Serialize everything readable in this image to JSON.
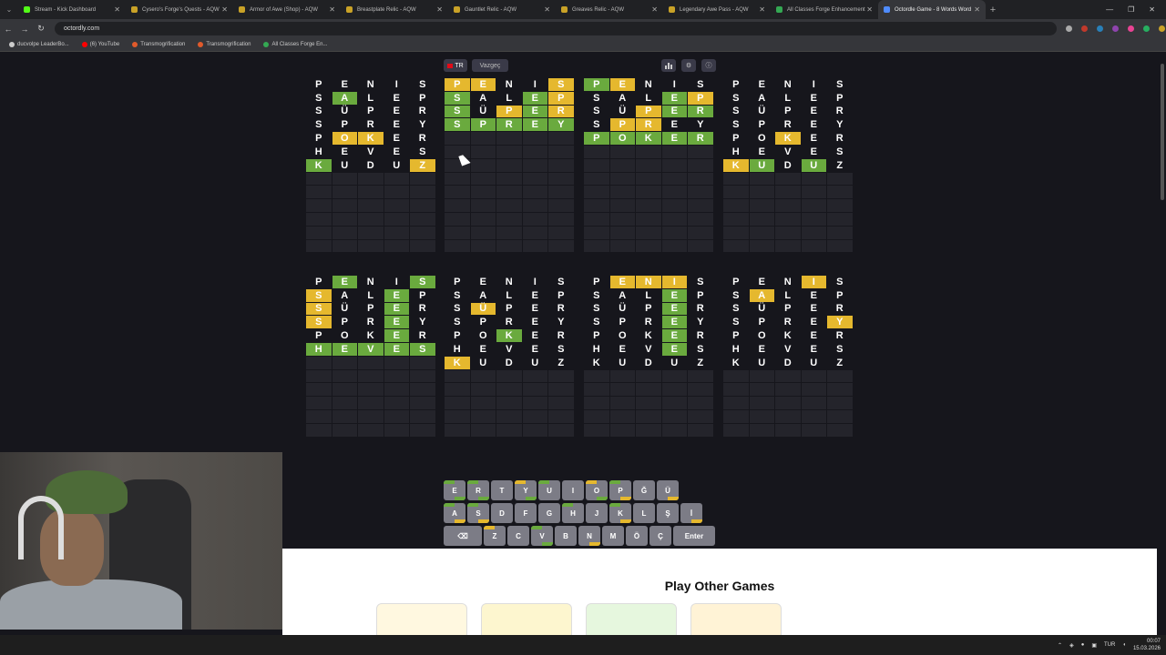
{
  "browser": {
    "tabs": [
      {
        "title": "Stream - Kick Dashboard",
        "color": "#53fc18"
      },
      {
        "title": "Cysero's Forge's Quests - AQW",
        "color": "#c9a227"
      },
      {
        "title": "Armor of Awe (Shop) - AQW",
        "color": "#c9a227"
      },
      {
        "title": "Breastplate Relic - AQW",
        "color": "#c9a227"
      },
      {
        "title": "Gauntlet Relic - AQW",
        "color": "#c9a227"
      },
      {
        "title": "Greaves Relic - AQW",
        "color": "#c9a227"
      },
      {
        "title": "Legendary Awe Pass - AQW",
        "color": "#c9a227"
      },
      {
        "title": "All Classes Forge Enhancement",
        "color": "#34a853"
      },
      {
        "title": "Octordle Game - 8 Words Word",
        "color": "#4f8cff"
      }
    ],
    "active_tab": 8,
    "url": "octordly.com",
    "bookmarks": [
      {
        "label": "ducvolpe LeaderBo...",
        "color": "#ccc"
      },
      {
        "label": "(6) YouTube",
        "color": "#ff0000"
      },
      {
        "label": "Transmogrification",
        "color": "#e05a2b"
      },
      {
        "label": "Transmogrification",
        "color": "#e05a2b"
      },
      {
        "label": "All Classes Forge En...",
        "color": "#34a853"
      }
    ]
  },
  "toolbar": {
    "lang_label": "TR",
    "giveup_label": "Vazgeç",
    "stats_icon": "bar-chart-icon",
    "settings_icon": "gear-icon",
    "info_icon": "info-icon"
  },
  "boards": [
    {
      "rows": [
        {
          "w": "PENIS",
          "s": "....."
        },
        {
          "w": "SALEP",
          "s": ".g..."
        },
        {
          "w": "SÜPER",
          "s": "....."
        },
        {
          "w": "SPREY",
          "s": "....."
        },
        {
          "w": "POKER",
          "s": ".yy.."
        },
        {
          "w": "HEVES",
          "s": "....."
        },
        {
          "w": "KUDUZ",
          "s": "g...y"
        }
      ]
    },
    {
      "rows": [
        {
          "w": "PENIS",
          "s": "yy..y"
        },
        {
          "w": "SALEP",
          "s": "g..gy"
        },
        {
          "w": "SÜPER",
          "s": "g.ygy"
        },
        {
          "w": "SPREY",
          "s": "ggggg"
        }
      ]
    },
    {
      "rows": [
        {
          "w": "PENIS",
          "s": "gy..."
        },
        {
          "w": "SALEP",
          "s": "...gy"
        },
        {
          "w": "SÜPER",
          "s": "..ygg"
        },
        {
          "w": "SPREY",
          "s": ".yy.."
        },
        {
          "w": "POKER",
          "s": "ggggg"
        }
      ]
    },
    {
      "rows": [
        {
          "w": "PENIS",
          "s": "....."
        },
        {
          "w": "SALEP",
          "s": "....."
        },
        {
          "w": "SÜPER",
          "s": "....."
        },
        {
          "w": "SPREY",
          "s": "....."
        },
        {
          "w": "POKER",
          "s": "..y.."
        },
        {
          "w": "HEVES",
          "s": "....."
        },
        {
          "w": "KUDUZ",
          "s": "yg.g."
        }
      ]
    },
    {
      "rows": [
        {
          "w": "PENIS",
          "s": ".g..g"
        },
        {
          "w": "SALEP",
          "s": "y..g."
        },
        {
          "w": "SÜPER",
          "s": "y..g."
        },
        {
          "w": "SPREY",
          "s": "y..g."
        },
        {
          "w": "POKER",
          "s": "...g."
        },
        {
          "w": "HEVES",
          "s": "ggggg"
        }
      ]
    },
    {
      "rows": [
        {
          "w": "PENIS",
          "s": "....."
        },
        {
          "w": "SALEP",
          "s": "....."
        },
        {
          "w": "SÜPER",
          "s": ".y..."
        },
        {
          "w": "SPREY",
          "s": "....."
        },
        {
          "w": "POKER",
          "s": "..g.."
        },
        {
          "w": "HEVES",
          "s": "....."
        },
        {
          "w": "KUDUZ",
          "s": "y...."
        }
      ]
    },
    {
      "rows": [
        {
          "w": "PENIS",
          "s": ".yyy."
        },
        {
          "w": "SALEP",
          "s": "...g."
        },
        {
          "w": "SÜPER",
          "s": "...g."
        },
        {
          "w": "SPREY",
          "s": "...g."
        },
        {
          "w": "POKER",
          "s": "...g."
        },
        {
          "w": "HEVES",
          "s": "...g."
        },
        {
          "w": "KUDUZ",
          "s": "....."
        }
      ]
    },
    {
      "rows": [
        {
          "w": "PENIS",
          "s": "...y."
        },
        {
          "w": "SALEP",
          "s": ".y..."
        },
        {
          "w": "SÜPER",
          "s": "....."
        },
        {
          "w": "SPREY",
          "s": "....y"
        },
        {
          "w": "POKER",
          "s": "....."
        },
        {
          "w": "HEVES",
          "s": "....."
        },
        {
          "w": "KUDUZ",
          "s": "....."
        }
      ]
    }
  ],
  "keyboard": {
    "rows": [
      [
        "E",
        "R",
        "T",
        "Y",
        "U",
        "I",
        "O",
        "P",
        "Ğ",
        "Ü"
      ],
      [
        "A",
        "S",
        "D",
        "F",
        "G",
        "H",
        "J",
        "K",
        "L",
        "Ş",
        "İ"
      ],
      [
        "⌫",
        "Z",
        "C",
        "V",
        "B",
        "N",
        "M",
        "Ö",
        "Ç",
        "Enter"
      ]
    ]
  },
  "other_games": {
    "heading": "Play Other Games"
  },
  "taskbar": {
    "lang": "TUR",
    "time": "00:07",
    "date": "15.03.2026"
  },
  "colors": {
    "green": "#6aaa3e",
    "yellow": "#e5b82e",
    "bg": "#16161c"
  }
}
